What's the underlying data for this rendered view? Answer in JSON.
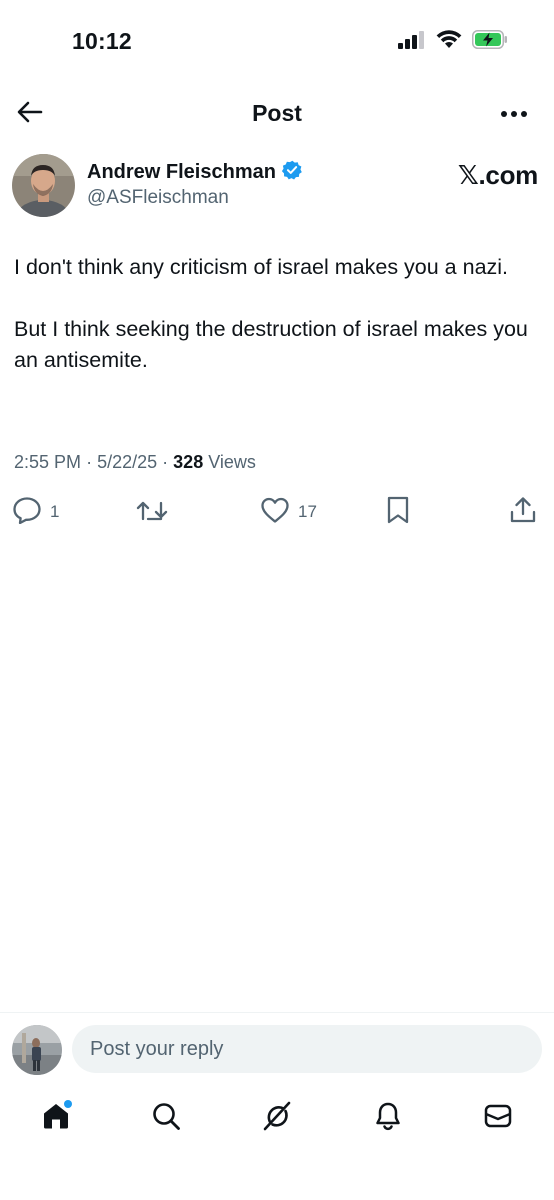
{
  "status_bar": {
    "time": "10:12",
    "battery_color": "#34c759"
  },
  "nav": {
    "title": "Post",
    "back_icon": "arrow-left-icon",
    "more_icon": "more-horizontal-icon"
  },
  "post": {
    "author": {
      "name": "Andrew Fleischman",
      "handle": "@ASFleischman",
      "verified": true,
      "verified_color": "#1d9bf0"
    },
    "source_mark": "𝕏.com",
    "text_paragraphs": [
      "I don't think any criticism of israel makes you a nazi.",
      "But I think seeking the destruction of israel makes you an antisemite."
    ],
    "time": "2:55 PM",
    "date": "5/22/25",
    "views_count": "328",
    "views_label": "Views",
    "separator": "·"
  },
  "actions": {
    "replies": "1",
    "reposts": "",
    "likes": "17"
  },
  "reply": {
    "placeholder": "Post your reply"
  },
  "tab_bar": {
    "tabs": [
      "home-icon",
      "search-icon",
      "grok-icon",
      "notifications-icon",
      "messages-icon"
    ],
    "home_has_unread_dot": true,
    "dot_color": "#1d9bf0"
  },
  "colors": {
    "text_primary": "#0f1419",
    "text_secondary": "#536471",
    "input_bg": "#eff3f4",
    "accent": "#1d9bf0"
  }
}
